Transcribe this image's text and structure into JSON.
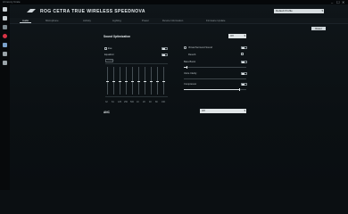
{
  "window": {
    "title": "Armoury Crate",
    "controls": [
      "–",
      "☐",
      "✕"
    ]
  },
  "sidebar": {
    "icons": [
      "home-icon",
      "settings-icon",
      "device-icon",
      "aura-icon",
      "gamevisual-icon",
      "scenario-icon",
      "download-icon"
    ]
  },
  "header": {
    "product_name": "ROG CETRA TRUE WIRELESS SPEEDNOVA",
    "profile": "Default Profile"
  },
  "tabs": [
    "Audio",
    "Microphone",
    "Activity",
    "Lighting",
    "Power",
    "Device Information",
    "Firmware Update"
  ],
  "reset_label": "Reset",
  "sound": {
    "title": "Sound Optimization",
    "preset": "Off",
    "eq_label": "Eve",
    "equalizer_label": "Equalizer",
    "preset_box": "Custom",
    "bands": [
      "32",
      "64",
      "125",
      "250",
      "500",
      "1K",
      "2K",
      "4K",
      "8K",
      "16K"
    ],
    "levels": [
      0,
      0,
      0,
      0,
      0,
      0,
      0,
      0,
      0,
      0
    ]
  },
  "right": {
    "virtual": "Virtual Surround Sound",
    "reverb": "Reverb",
    "bass_boost": "Bass Boost",
    "voice_clarity": "Voice Clarity",
    "compressor": "Compressor"
  },
  "anc": {
    "title": "ANC",
    "value": "Off"
  }
}
